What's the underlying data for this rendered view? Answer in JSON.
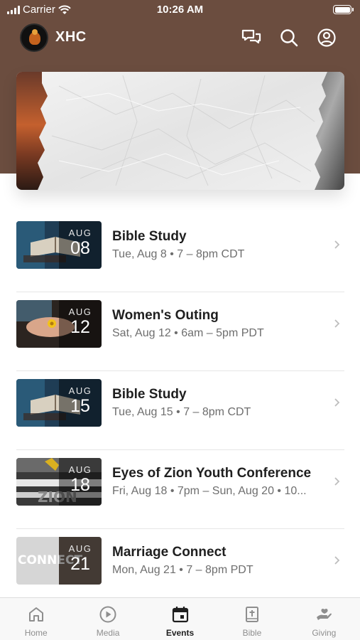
{
  "status_bar": {
    "carrier": "Carrier",
    "time": "10:26 AM"
  },
  "header": {
    "title": "XHC",
    "icons": [
      "chat-icon",
      "search-icon",
      "account-icon"
    ],
    "brand_color": "#6b4d3f"
  },
  "banner": {
    "image": "crumpled-paper-banner"
  },
  "events": [
    {
      "title": "Bible Study",
      "month": "AUG",
      "day": "08",
      "time": "Tue, Aug 8 • 7 – 8pm CDT",
      "thumbnail": "bible-thumbnail"
    },
    {
      "title": "Women's Outing",
      "month": "AUG",
      "day": "12",
      "time": "Sat, Aug 12 • 6am – 5pm PDT",
      "thumbnail": "hands-flower-thumbnail"
    },
    {
      "title": "Bible Study",
      "month": "AUG",
      "day": "15",
      "time": "Tue, Aug 15 • 7 – 8pm CDT",
      "thumbnail": "bible-thumbnail"
    },
    {
      "title": "Eyes of Zion Youth Conference",
      "month": "AUG",
      "day": "18",
      "time": "Fri, Aug 18 • 7pm – Sun, Aug 20 • 10...",
      "thumbnail": "zion-thumbnail"
    },
    {
      "title": "Marriage Connect",
      "month": "AUG",
      "day": "21",
      "time": "Mon, Aug 21 • 7 – 8pm PDT",
      "thumbnail": "marriage-connect-thumbnail",
      "thumbnail_text": "CONNECT"
    }
  ],
  "tabs": [
    {
      "label": "Home",
      "icon": "home-icon",
      "active": false
    },
    {
      "label": "Media",
      "icon": "play-icon",
      "active": false
    },
    {
      "label": "Events",
      "icon": "calendar-icon",
      "active": true
    },
    {
      "label": "Bible",
      "icon": "bible-icon",
      "active": false
    },
    {
      "label": "Giving",
      "icon": "giving-icon",
      "active": false
    }
  ]
}
